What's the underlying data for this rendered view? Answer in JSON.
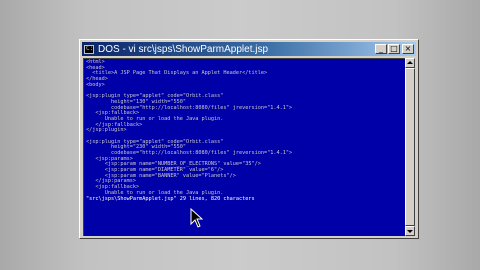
{
  "window": {
    "title": "DOS - vi src\\jsps\\ShowParmApplet.jsp",
    "icon": "console-icon",
    "buttons": {
      "minimize": "_",
      "maximize": "□",
      "close": "×"
    }
  },
  "editor": {
    "lines": [
      "<html>",
      "<head>",
      "  <title>A JSP Page That Displays an Applet Header</title>",
      "</head>",
      "<body>",
      "",
      "<jsp:plugin type=\"applet\" code=\"Orbit.class\"",
      "        height=\"130\" width=\"550\"",
      "        codebase=\"http://localhost:8080/files\" jreversion=\"1.4.1\">",
      "   <jsp:fallback>",
      "      Unable to run or load the Java plugin.",
      "   </jsp:fallback>",
      "</jsp:plugin>",
      "",
      "<jsp:plugin type=\"applet\" code=\"Orbit.class\"",
      "        height=\"230\" width=\"550\"",
      "        codebase=\"http://localhost:8080/files\" jreversion=\"1.4.1\">",
      "   <jsp:params>",
      "      <jsp:param name=\"NUMBER_OF_ELECTRONS\" value=\"35\"/>",
      "      <jsp:param name=\"DIAMETER\" value=\"6\"/>",
      "      <jsp:param name=\"BANNER\" value=\"Planets\"/>",
      "   </jsp:params>",
      "   <jsp:fallback>",
      "      Unable to run or load the Java plugin."
    ],
    "status": "\"src\\jsps\\ShowParmApplet.jsp\" 29 lines, 820 characters"
  },
  "colors": {
    "console_bg": "#0000a8",
    "console_text": "#c8c8c8",
    "titlebar_start": "#0a246a",
    "titlebar_end": "#a6caf0"
  }
}
